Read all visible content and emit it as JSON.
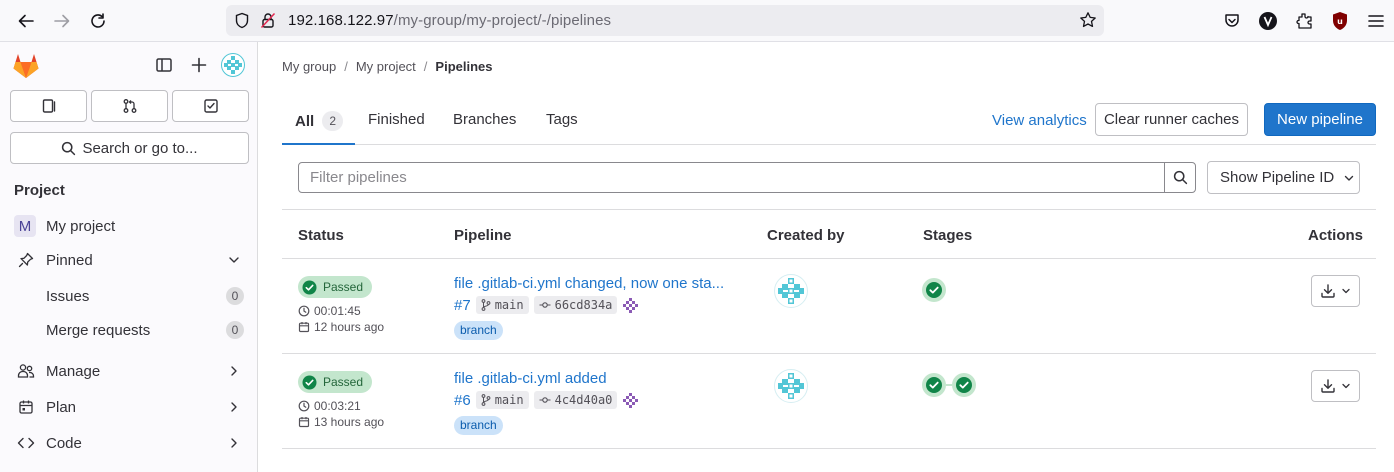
{
  "browser": {
    "url_host": "192.168.122.97",
    "url_path": "/my-group/my-project/-/pipelines"
  },
  "sidebar": {
    "search_label": "Search or go to...",
    "section_heading": "Project",
    "project_initial": "M",
    "project_name": "My project",
    "pinned_label": "Pinned",
    "pinned_items": [
      {
        "label": "Issues",
        "count": "0"
      },
      {
        "label": "Merge requests",
        "count": "0"
      }
    ],
    "nav_items": [
      {
        "label": "Manage",
        "icon": "users-icon"
      },
      {
        "label": "Plan",
        "icon": "calendar-icon"
      },
      {
        "label": "Code",
        "icon": "code-icon"
      }
    ]
  },
  "breadcrumb": {
    "items": [
      "My group",
      "My project"
    ],
    "current": "Pipelines"
  },
  "tabs": {
    "all_label": "All",
    "all_count": "2",
    "finished_label": "Finished",
    "branches_label": "Branches",
    "tags_label": "Tags"
  },
  "actions": {
    "view_analytics": "View analytics",
    "clear_caches": "Clear runner caches",
    "new_pipeline": "New pipeline"
  },
  "filter": {
    "placeholder": "Filter pipelines",
    "dropdown_label": "Show Pipeline ID"
  },
  "table": {
    "headers": {
      "status": "Status",
      "pipeline": "Pipeline",
      "created_by": "Created by",
      "stages": "Stages",
      "actions": "Actions"
    },
    "rows": [
      {
        "status": "Passed",
        "duration": "00:01:45",
        "finished": "12 hours ago",
        "title": "file .gitlab-ci.yml changed, now one sta...",
        "id": "#7",
        "ref": "main",
        "sha": "66cd834a",
        "badge": "branch",
        "stages_count": 1
      },
      {
        "status": "Passed",
        "duration": "00:03:21",
        "finished": "13 hours ago",
        "title": "file .gitlab-ci.yml added",
        "id": "#6",
        "ref": "main",
        "sha": "4c4d40a0",
        "badge": "branch",
        "stages_count": 2
      }
    ]
  },
  "colors": {
    "primary": "#1f75cb",
    "success": "#108548",
    "success_bg": "#c3e6cd"
  }
}
